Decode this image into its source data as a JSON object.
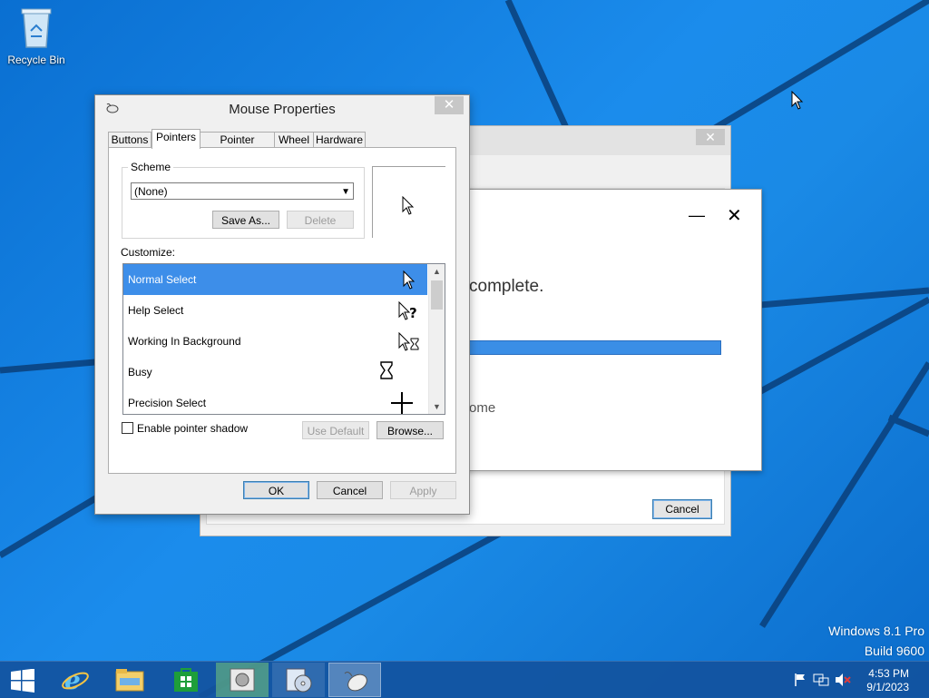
{
  "desktop": {
    "recycle_bin_label": "Recycle Bin",
    "watermark_line1": "Windows 8.1 Pro",
    "watermark_line2": "Build 9600"
  },
  "bg_window_setup": {
    "close_glyph": "✕",
    "cancel_label": "Cancel"
  },
  "bg_window_modern": {
    "minimize_glyph": "—",
    "close_glyph": "✕",
    "message_fragment": "complete.",
    "footer_fragment": "ome",
    "progress_fraction": 1.0
  },
  "dialog": {
    "title": "Mouse Properties",
    "close_glyph": "✕",
    "tabs": [
      "Buttons",
      "Pointers",
      "Pointer Options",
      "Wheel",
      "Hardware"
    ],
    "active_tab": "Pointers",
    "scheme": {
      "legend": "Scheme",
      "selected": "(None)",
      "save_as_label": "Save As...",
      "delete_label": "Delete"
    },
    "customize_label": "Customize:",
    "pointers": [
      {
        "label": "Normal Select",
        "icon": "arrow-cursor-icon",
        "selected": true
      },
      {
        "label": "Help Select",
        "icon": "help-cursor-icon",
        "selected": false
      },
      {
        "label": "Working In Background",
        "icon": "working-cursor-icon",
        "selected": false
      },
      {
        "label": "Busy",
        "icon": "hourglass-cursor-icon",
        "selected": false
      },
      {
        "label": "Precision Select",
        "icon": "crosshair-cursor-icon",
        "selected": false
      }
    ],
    "shadow_checkbox_label": "Enable pointer shadow",
    "shadow_checked": false,
    "use_default_label": "Use Default",
    "browse_label": "Browse...",
    "ok_label": "OK",
    "cancel_label": "Cancel",
    "apply_label": "Apply"
  },
  "taskbar": {
    "items": [
      "start-icon",
      "internet-explorer-icon",
      "file-explorer-icon",
      "store-icon",
      "setup-app-icon",
      "setup-disc-icon",
      "mouse-icon"
    ],
    "time": "4:53 PM",
    "date": "9/1/2023"
  },
  "colors": {
    "desktop_blue": "#1b8cec",
    "selection_blue": "#3d8ee9",
    "taskbar": "#12529e"
  }
}
